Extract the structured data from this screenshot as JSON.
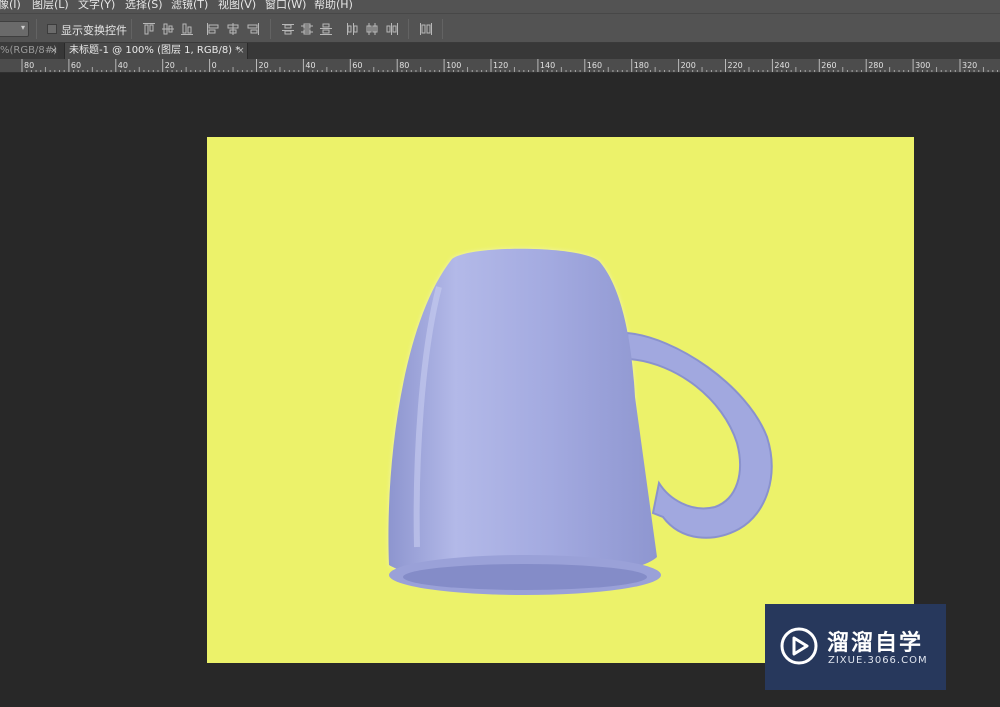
{
  "menu": {
    "items": [
      "像(I)",
      "图层(L)",
      "文字(Y)",
      "选择(S)",
      "滤镜(T)",
      "视图(V)",
      "窗口(W)",
      "帮助(H)"
    ]
  },
  "options": {
    "show_transform_label": "显示变换控件",
    "show_transform_checked": false,
    "align_icons": [
      "align-top-edges-icon",
      "align-vertical-centers-icon",
      "align-bottom-edges-icon",
      "align-left-edges-icon",
      "align-horizontal-centers-icon",
      "align-right-edges-icon",
      "distribute-top-icon",
      "distribute-vertical-centers-icon",
      "distribute-bottom-icon",
      "distribute-left-icon",
      "distribute-horizontal-centers-icon",
      "distribute-right-icon",
      "auto-align-icon"
    ]
  },
  "tabs": {
    "inactive_label": "%(RGB/8#)",
    "active_label": "未标题-1 @ 100% (图层 1, RGB/8) *",
    "close_glyph": "×"
  },
  "ruler": {
    "labels": [
      "80",
      "60",
      "40",
      "20",
      "0",
      "20",
      "40",
      "60",
      "80",
      "100",
      "120",
      "140",
      "160",
      "180",
      "200",
      "220",
      "240",
      "260",
      "280",
      "300",
      "320"
    ]
  },
  "document": {
    "background_color": "#ecf26a",
    "mug_color": "#a7aee0"
  },
  "watermark": {
    "title": "溜溜自学",
    "url": "ZIXUE.3066.COM",
    "background_color": "#27385c"
  }
}
